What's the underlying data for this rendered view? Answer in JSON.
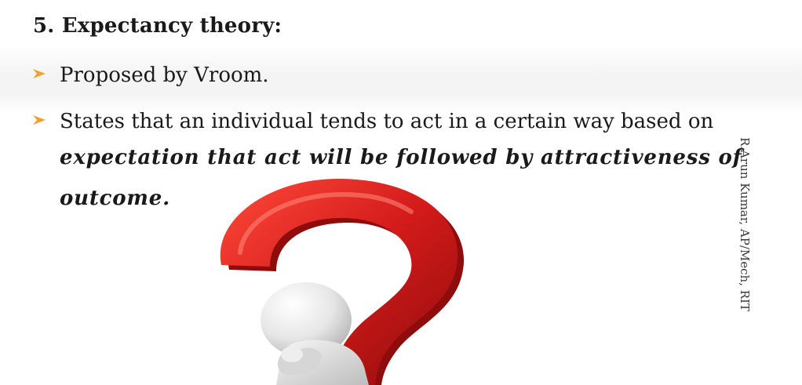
{
  "heading": "5. Expectancy theory:",
  "bullets": [
    "Proposed by Vroom.",
    "States that an individual tends to act in a certain way based on"
  ],
  "emphasis_line_1": "expectation that act will be followed by attractiveness of",
  "emphasis_line_2": "outcome.",
  "byline": "R.Arun Kumar, AP/Mech, RIT",
  "colors": {
    "bullet_arrow": "#f0a030",
    "question_mark": "#d21a1a",
    "figure": "#e8e8e8"
  },
  "icons": {
    "bullet": "arrow-bullet-icon",
    "illustration": "question-mark-figure"
  }
}
